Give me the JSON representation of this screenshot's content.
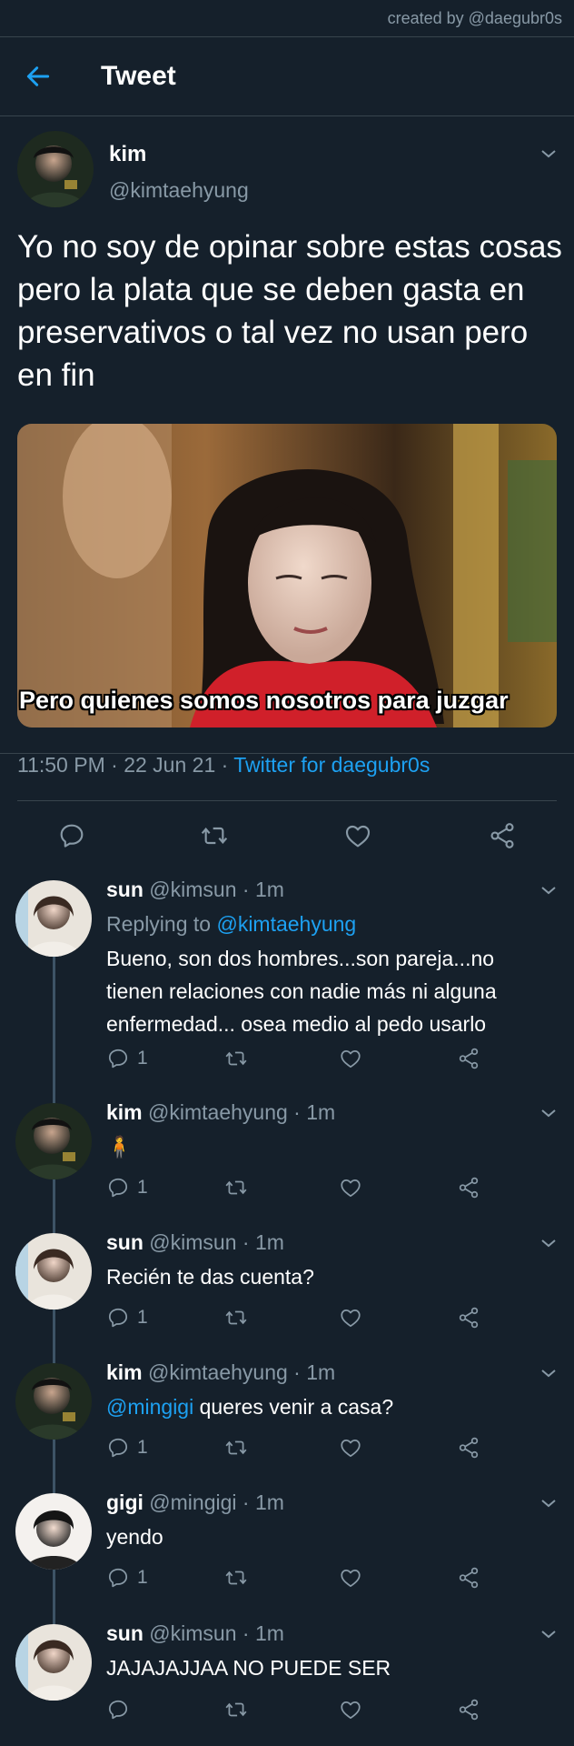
{
  "credit": "created by @daegubr0s",
  "header": {
    "title": "Tweet"
  },
  "tweet": {
    "name": "kim",
    "handle": "@kimtaehyung",
    "text": "Yo no soy de opinar sobre estas cosas pero la plata que se deben gasta en preservativos o tal vez no usan pero en fin",
    "media_caption": "Pero quienes somos nosotros para juzgar",
    "time": "11:50 PM",
    "date": "22 Jun 21",
    "source": "Twitter for daegubr0s"
  },
  "replies": [
    {
      "name": "sun",
      "handle": "@kimsun",
      "time": "1m",
      "replying_prefix": "Replying to ",
      "replying_to": "@kimtaehyung",
      "text": "Bueno, son dos hombres...son pareja...no tienen relaciones con nadie más ni alguna enfermedad... osea medio al pedo usarlo",
      "reply_count": "1"
    },
    {
      "name": "kim",
      "handle": "@kimtaehyung",
      "time": "1m",
      "text": "🧍",
      "reply_count": "1"
    },
    {
      "name": "sun",
      "handle": "@kimsun",
      "time": "1m",
      "text": "Recién te das cuenta?",
      "reply_count": "1"
    },
    {
      "name": "kim",
      "handle": "@kimtaehyung",
      "time": "1m",
      "mention": "@mingigi",
      "text": " queres venir a casa?",
      "reply_count": "1"
    },
    {
      "name": "gigi",
      "handle": "@mingigi",
      "time": "1m",
      "text": "yendo",
      "reply_count": "1"
    },
    {
      "name": "sun",
      "handle": "@kimsun",
      "time": "1m",
      "text": "JAJAJAJJAA NO PUEDE SER",
      "reply_count": ""
    }
  ],
  "icons": {
    "back": "arrow-left-icon",
    "chevron": "chevron-down-icon",
    "reply": "comment-bubble-icon",
    "retweet": "retweet-icon",
    "like": "heart-icon",
    "share": "share-icon"
  },
  "colors": {
    "background": "#15202b",
    "accent": "#1da1f2",
    "secondary_text": "#8899a6",
    "divider": "#38444d"
  }
}
